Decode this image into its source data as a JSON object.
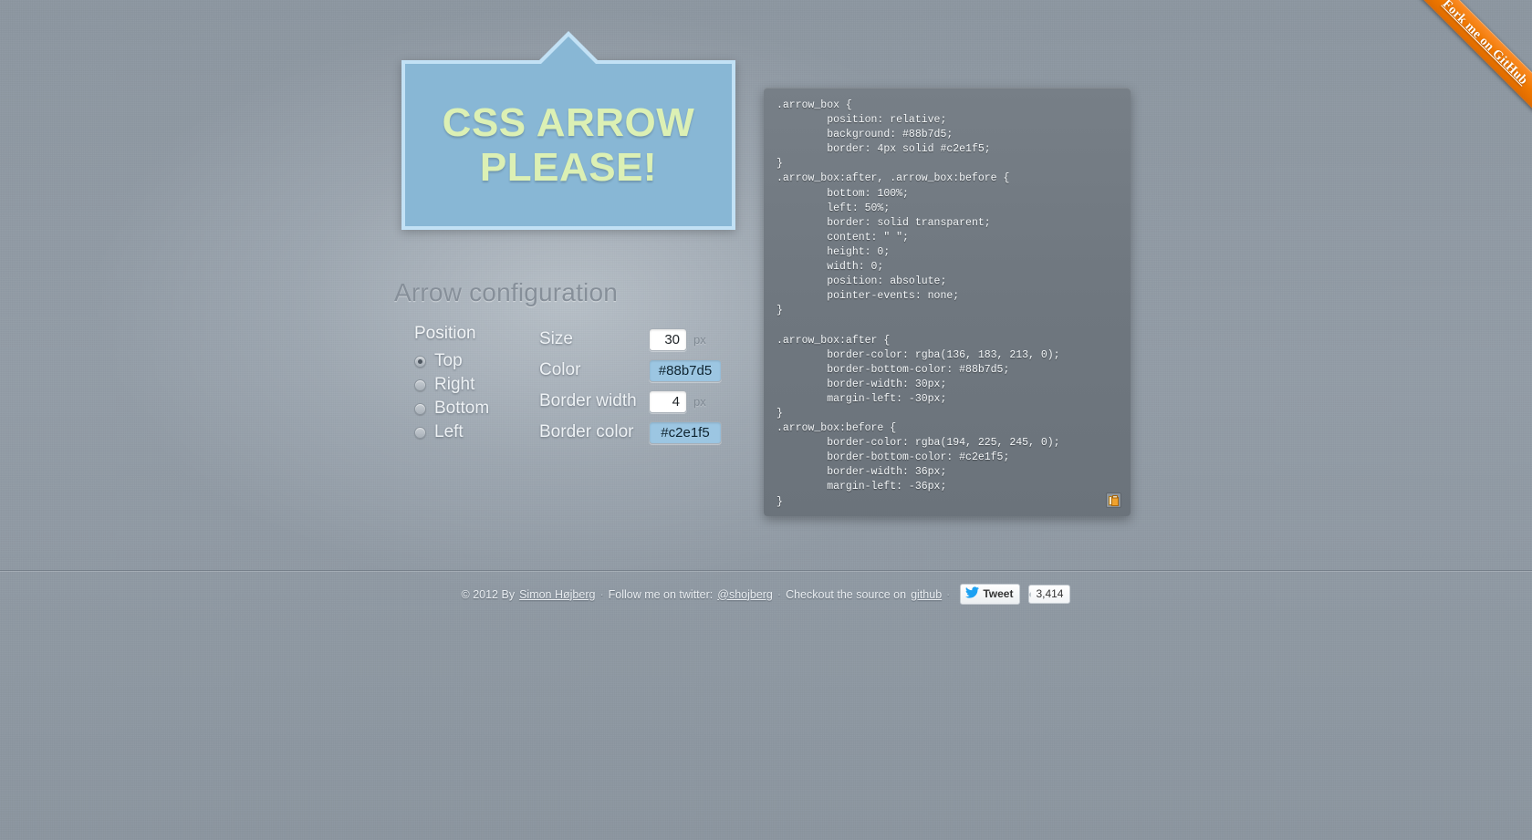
{
  "ribbon": {
    "label": "Fork me on GitHub",
    "color": "#f07800"
  },
  "preview": {
    "text": "CSS arrow please!",
    "background": "#88b7d5",
    "border_color": "#c2e1f5",
    "text_color": "#dcf0b4",
    "arrow_size": 30,
    "border_width": 4,
    "position": "top"
  },
  "config": {
    "title": "Arrow configuration",
    "position_group_label": "Position",
    "positions": [
      {
        "label": "Top",
        "checked": true
      },
      {
        "label": "Right",
        "checked": false
      },
      {
        "label": "Bottom",
        "checked": false
      },
      {
        "label": "Left",
        "checked": false
      }
    ],
    "fields": [
      {
        "label": "Size",
        "value": "30",
        "unit": "px",
        "kind": "num"
      },
      {
        "label": "Color",
        "value": "#88b7d5",
        "unit": "",
        "kind": "color"
      },
      {
        "label": "Border width",
        "value": "4",
        "unit": "px",
        "kind": "num"
      },
      {
        "label": "Border color",
        "value": "#c2e1f5",
        "unit": "",
        "kind": "color"
      }
    ]
  },
  "code": {
    "copy_icon": "clipboard-icon",
    "css": ".arrow_box {\n\tposition: relative;\n\tbackground: #88b7d5;\n\tborder: 4px solid #c2e1f5;\n}\n.arrow_box:after, .arrow_box:before {\n\tbottom: 100%;\n\tleft: 50%;\n\tborder: solid transparent;\n\tcontent: \" \";\n\theight: 0;\n\twidth: 0;\n\tposition: absolute;\n\tpointer-events: none;\n}\n\n.arrow_box:after {\n\tborder-color: rgba(136, 183, 213, 0);\n\tborder-bottom-color: #88b7d5;\n\tborder-width: 30px;\n\tmargin-left: -30px;\n}\n.arrow_box:before {\n\tborder-color: rgba(194, 225, 245, 0);\n\tborder-bottom-color: #c2e1f5;\n\tborder-width: 36px;\n\tmargin-left: -36px;\n}"
  },
  "footer": {
    "copyright": "© 2012 By",
    "author": "Simon Højberg",
    "sep1": "·",
    "follow_text": "Follow me on twitter:",
    "twitter_handle": "@shojberg",
    "sep2": "·",
    "source_text": "Checkout the source on",
    "source_link": "github",
    "sep3": "·",
    "tweet_label": "Tweet",
    "tweet_count": "3,414"
  }
}
